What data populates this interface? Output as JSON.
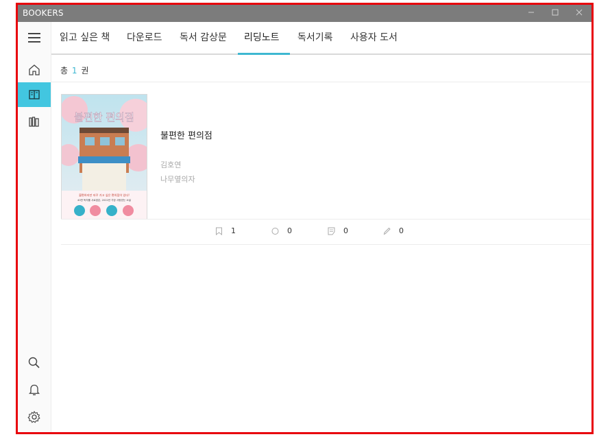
{
  "window": {
    "title": "BOOKERS"
  },
  "tabs": [
    {
      "label": "읽고 싶은 책"
    },
    {
      "label": "다운로드"
    },
    {
      "label": "독서 감상문"
    },
    {
      "label": "리딩노트"
    },
    {
      "label": "독서기록"
    },
    {
      "label": "사용자 도서"
    }
  ],
  "active_tab": "리딩노트",
  "summary": {
    "prefix": "총",
    "count": "1",
    "suffix": "권"
  },
  "book": {
    "title": "불편한 편의점",
    "author": "김호연",
    "publisher": "나무옆의자",
    "cover_title_art": "불편한 편의점",
    "cover_tagline_1": "불편하지만 자꾸 가고 싶은 편의점이 있다!",
    "cover_tagline_2": "40만 독자를 사로잡은, 2022년 가장 사랑받는 소설"
  },
  "stats": [
    {
      "icon": "bookmark-icon",
      "value": "1"
    },
    {
      "icon": "circle-icon",
      "value": "0"
    },
    {
      "icon": "memo-icon",
      "value": "0"
    },
    {
      "icon": "pencil-icon",
      "value": "0"
    }
  ],
  "colors": {
    "accent": "#42c6e0",
    "titlebar": "#7c7c7c",
    "frame": "#e8000b"
  }
}
